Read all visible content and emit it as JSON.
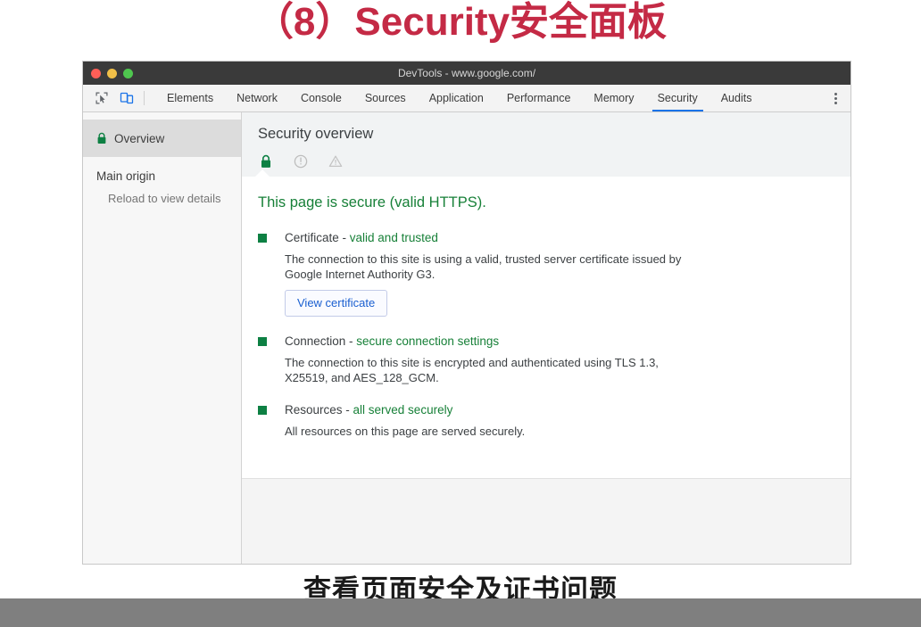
{
  "slide": {
    "title": "（8）Security安全面板",
    "title_color": "#c42a45",
    "caption": "查看页面安全及证书问题"
  },
  "window": {
    "titlebar_text": "DevTools - www.google.com/",
    "traffic_lights": [
      "close-red",
      "minimize-yellow",
      "zoom-green"
    ]
  },
  "toolbar": {
    "inspect_icon": "inspect-element-icon",
    "device_icon": "device-toolbar-icon",
    "more_icon": "kebab-menu-icon"
  },
  "tabs": [
    {
      "label": "Elements",
      "active": false
    },
    {
      "label": "Network",
      "active": false
    },
    {
      "label": "Console",
      "active": false
    },
    {
      "label": "Sources",
      "active": false
    },
    {
      "label": "Application",
      "active": false
    },
    {
      "label": "Performance",
      "active": false
    },
    {
      "label": "Memory",
      "active": false
    },
    {
      "label": "Security",
      "active": true
    },
    {
      "label": "Audits",
      "active": false
    }
  ],
  "active_tab_underline_color": "#1a73e8",
  "sidebar": {
    "overview_label": "Overview",
    "overview_icon": "green-lock-icon",
    "group_label": "Main origin",
    "group_sub_label": "Reload to view details"
  },
  "content": {
    "header_title": "Security overview",
    "summary_icons": [
      "lock-icon",
      "info-circle-icon",
      "warning-triangle-icon"
    ],
    "secure_message": "This page is secure (valid HTTPS).",
    "secure_color": "#178038",
    "sections": [
      {
        "title": "Certificate - ",
        "status": "valid and trusted",
        "body": "The connection to this site is using a valid, trusted server certificate issued by Google Internet Authority G3.",
        "button": "View certificate"
      },
      {
        "title": "Connection - ",
        "status": "secure connection settings",
        "body": "The connection to this site is encrypted and authenticated using TLS 1.3, X25519, and AES_128_GCM.",
        "button": null
      },
      {
        "title": "Resources - ",
        "status": "all served securely",
        "body": "All resources on this page are served securely.",
        "button": null
      }
    ]
  }
}
